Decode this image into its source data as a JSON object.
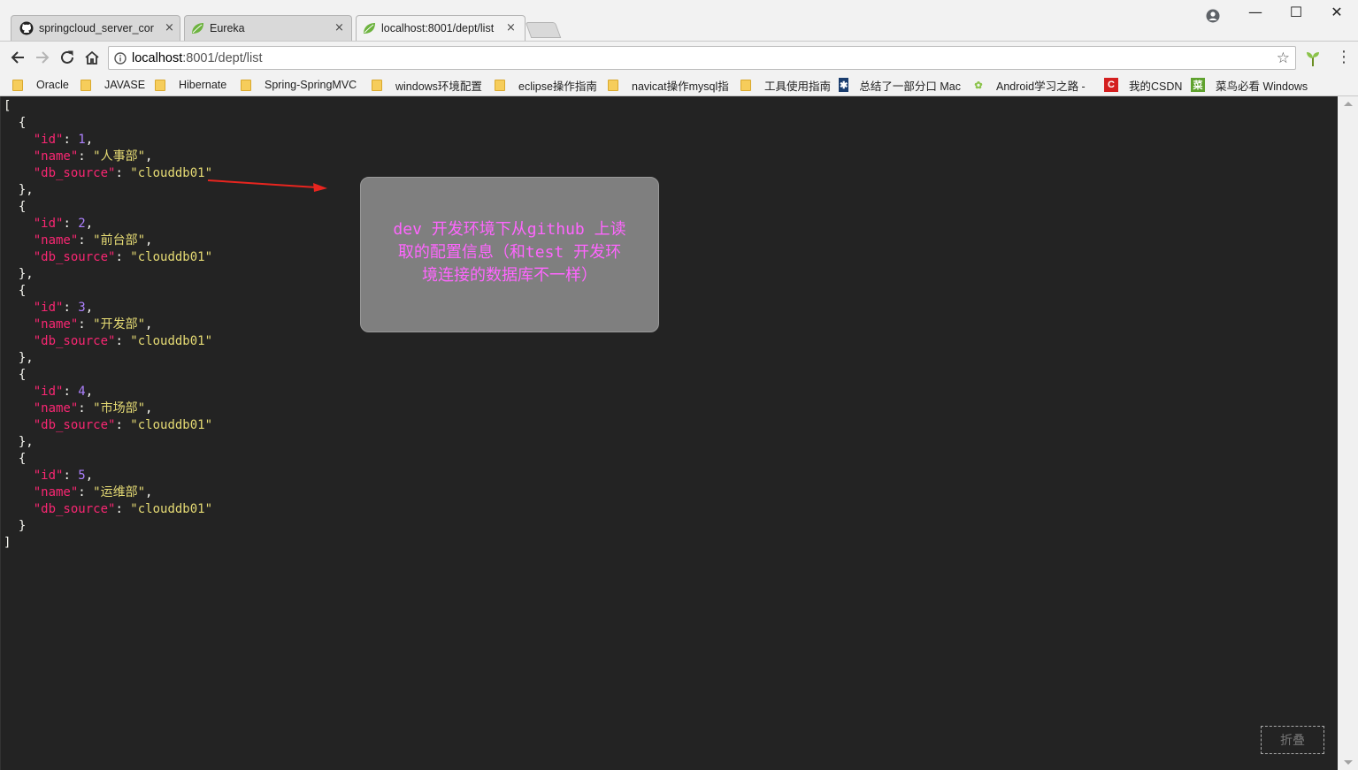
{
  "tabs": [
    {
      "title": "springcloud_server_cor",
      "icon": "github-icon",
      "close": "×"
    },
    {
      "title": "Eureka",
      "icon": "spring-leaf-icon",
      "close": "×"
    },
    {
      "title": "localhost:8001/dept/list",
      "icon": "spring-leaf-icon",
      "close": "×",
      "active": true
    }
  ],
  "window_controls": {
    "minimize": "—",
    "maximize": "☐",
    "close": "✕"
  },
  "omnibox": {
    "host": "localhost",
    "path": ":8001/dept/list"
  },
  "bookmarks": [
    {
      "label": "Oracle",
      "icon": "folder-icon"
    },
    {
      "label": "JAVASE",
      "icon": "folder-icon"
    },
    {
      "label": "Hibernate",
      "icon": "folder-icon"
    },
    {
      "label": "Spring-SpringMVC",
      "icon": "folder-icon"
    },
    {
      "label": "windows环境配置",
      "icon": "folder-icon"
    },
    {
      "label": "eclipse操作指南",
      "icon": "folder-icon"
    },
    {
      "label": "navicat操作mysql指",
      "icon": "folder-icon"
    },
    {
      "label": "工具使用指南",
      "icon": "folder-icon"
    },
    {
      "label": "总结了一部分口 Mac",
      "icon": "site-icon"
    },
    {
      "label": "Android学习之路 -",
      "icon": "android-icon"
    },
    {
      "label": "我的CSDN",
      "icon": "csdn-icon"
    },
    {
      "label": "菜鸟必看 Windows",
      "icon": "site-icon"
    }
  ],
  "json_records": [
    {
      "id": "1",
      "name": "人事部",
      "db_source": "clouddb01"
    },
    {
      "id": "2",
      "name": "前台部",
      "db_source": "clouddb01"
    },
    {
      "id": "3",
      "name": "开发部",
      "db_source": "clouddb01"
    },
    {
      "id": "4",
      "name": "市场部",
      "db_source": "clouddb01"
    },
    {
      "id": "5",
      "name": "运维部",
      "db_source": "clouddb01"
    }
  ],
  "json_keys": {
    "id": "\"id\"",
    "name": "\"name\"",
    "db_source": "\"db_source\""
  },
  "annotation": {
    "line1": "dev 开发环境下从github 上读",
    "line2": "取的配置信息（和test 开发环",
    "line3": "境连接的数据库不一样）",
    "arrow_color": "#e8251f",
    "text_color": "#ff66ff"
  },
  "fold_button": "折叠",
  "colors": {
    "key": "#f92672",
    "number": "#ae81ff",
    "string": "#e6db74",
    "background": "#232323"
  }
}
